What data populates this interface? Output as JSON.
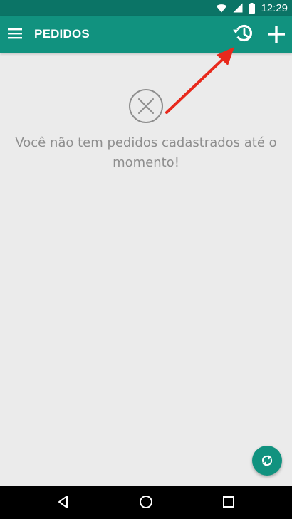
{
  "status_bar": {
    "time": "12:29",
    "icons": [
      "wifi-icon",
      "signal-icon",
      "battery-icon"
    ]
  },
  "app_bar": {
    "title": "PEDIDOS",
    "menu_icon": "menu-icon",
    "actions": [
      "history-icon",
      "add-icon"
    ]
  },
  "empty_state": {
    "icon": "close-circle-icon",
    "message_line1": "Você não tem pedidos cadastrados até o",
    "message_line2": "momento!"
  },
  "fab": {
    "icon": "sync-icon"
  },
  "nav_bar": {
    "icons": [
      "back-icon",
      "home-icon",
      "recents-icon"
    ]
  },
  "colors": {
    "app_bar": "#11927f",
    "status_bar": "#0b7466",
    "background": "#ebebeb",
    "text_muted": "#8e8e8e",
    "annotation_arrow": "#e8291c"
  }
}
